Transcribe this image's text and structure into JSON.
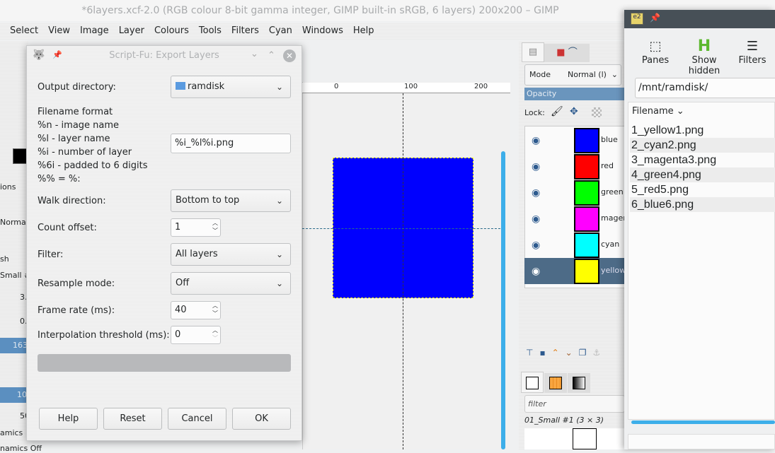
{
  "window": {
    "title": "*6layers.xcf-2.0 (RGB colour 8-bit gamma integer, GIMP built-in sRGB, 6 layers) 200x200 – GIMP"
  },
  "menu": [
    "Select",
    "View",
    "Image",
    "Layer",
    "Colours",
    "Tools",
    "Filters",
    "Cyan",
    "Windows",
    "Help"
  ],
  "toolbox_fragments": [
    "ions",
    "Norma",
    "sh",
    "Small #",
    "3.",
    "0.",
    "163.",
    "10",
    "50",
    "amics",
    "namics Off"
  ],
  "ruler": {
    "ticks": [
      "0",
      "100",
      "200"
    ]
  },
  "canvas": {
    "layer_color": "#0000fe"
  },
  "layers_dock": {
    "mode_label": "Mode",
    "mode_value": "Normal (l)",
    "opacity_label": "Opacity",
    "lock_label": "Lock:",
    "layers": [
      {
        "name": "blue",
        "color": "#0000ff"
      },
      {
        "name": "red",
        "color": "#ff0000"
      },
      {
        "name": "green",
        "color": "#00ff00"
      },
      {
        "name": "magenta",
        "color": "#ff00ff"
      },
      {
        "name": "cyan",
        "color": "#00ffff"
      },
      {
        "name": "yellow",
        "color": "#ffff00",
        "selected": true
      }
    ],
    "brush_filter_placeholder": "filter",
    "brush_name": "01_Small #1 (3 × 3)"
  },
  "file_manager": {
    "toolbar": {
      "panes": "Panes",
      "show_hidden": "Show hidden",
      "filters": "Filters"
    },
    "path": "/mnt/ramdisk/",
    "column": "Filename",
    "files": [
      "1_yellow1.png",
      "2_cyan2.png",
      "3_magenta3.png",
      "4_green4.png",
      "5_red5.png",
      "6_blue6.png"
    ],
    "accent": "#3daee9"
  },
  "dialog": {
    "title": "Script-Fu: Export Layers",
    "output_directory_label": "Output directory:",
    "output_directory": "ramdisk",
    "format_help": [
      "Filename format",
      "%n - image name",
      "%l - layer name",
      "%i - number of layer",
      "%6i - padded to 6 digits",
      "%% = %:"
    ],
    "filename_format": "%i_%l%i.png",
    "walk_label": "Walk direction:",
    "walk_value": "Bottom to top",
    "count_label": "Count offset:",
    "count_value": "1",
    "filter_label": "Filter:",
    "filter_value": "All layers",
    "resample_label": "Resample mode:",
    "resample_value": "Off",
    "frame_label": "Frame rate (ms):",
    "frame_value": "40",
    "interp_label": "Interpolation threshold (ms):",
    "interp_value": "0",
    "progress": 0,
    "buttons": {
      "help": "Help",
      "reset": "Reset",
      "cancel": "Cancel",
      "ok": "OK"
    }
  }
}
